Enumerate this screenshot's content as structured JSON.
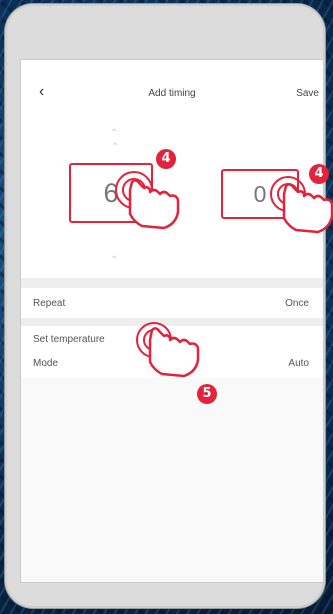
{
  "header": {
    "back_icon": "chevron-left-icon",
    "title": "Add timing",
    "save_label": "Save"
  },
  "picker": {
    "hour_value": "6",
    "minute_value": "0"
  },
  "settings": {
    "repeat_label": "Repeat",
    "repeat_value": "Once",
    "set_temperature_label": "Set temperature",
    "mode_label": "Mode",
    "mode_value": "Auto"
  },
  "callouts": {
    "step_hour": "4",
    "step_minute": "4",
    "step_temperature": "5"
  },
  "colors": {
    "accent": "#e2233b"
  }
}
